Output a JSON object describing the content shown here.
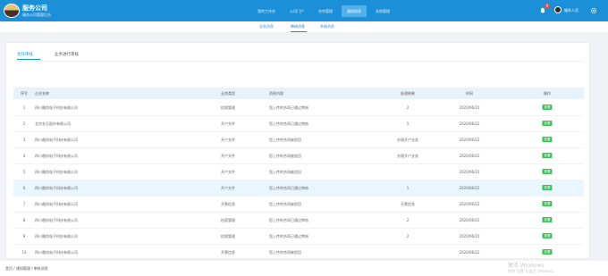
{
  "header": {
    "title": "服务公司",
    "subtitle": "服务公司管理后台",
    "nav": [
      "我的工作台",
      "公司门户",
      "合作管理",
      "通知消息",
      "系统管理"
    ],
    "active_nav": 3,
    "notification_count": "0",
    "user_name": "服务人员"
  },
  "subnav": {
    "items": [
      "业务消息",
      "审核消息",
      "系统消息"
    ],
    "active": 1
  },
  "tabs": {
    "items": [
      "合作审核",
      "业务进行审核"
    ],
    "active": 0
  },
  "table": {
    "columns": [
      "序号",
      "企业名称",
      "业务类型",
      "消息内容",
      "处理结果",
      "时间",
      "操作"
    ],
    "rows": [
      [
        "1",
        "四川雅尚电子科技有限公司",
        "档案管理",
        "您上传的合同已通过审核",
        "2",
        "2020/06/22",
        "查看"
      ],
      [
        "2",
        "北京金石股份有限公司",
        "开户文件",
        "您上传的合同已通过审核",
        "1",
        "2020/06/22",
        "查看"
      ],
      [
        "3",
        "四川雅尚电子科技有限公司",
        "开户文件",
        "您上传的合同被驳回",
        "办理开户业务",
        "2020/06/22",
        "查看"
      ],
      [
        "4",
        "四川雅尚电子科技有限公司",
        "开户文件",
        "您上传的合同被驳回",
        "办理开户业务",
        "2020/06/22",
        "查看"
      ],
      [
        "5",
        "四川雅尚电子科技有限公司",
        "开户文件",
        "您上传的合同被驳回",
        "",
        "2020/06/22",
        "查看"
      ],
      [
        "6",
        "四川雅尚电子科技有限公司",
        "开户文件",
        "您上传的合同已通过审核",
        "1",
        "2020/06/22",
        "查看"
      ],
      [
        "7",
        "四川雅尚电子科技有限公司",
        "开票信息",
        "您上传的合同被驳回",
        "开票信息",
        "2020/06/22",
        "查看"
      ],
      [
        "8",
        "四川雅尚电子科技有限公司",
        "档案管理",
        "您上传的合同已通过审核",
        "2",
        "2020/06/22",
        "查看"
      ],
      [
        "9",
        "四川雅尚电子科技有限公司",
        "档案管理",
        "您上传的合同已通过审核",
        "2",
        "2020/06/22",
        "查看"
      ],
      [
        "10",
        "四川雅尚电子科技有限公司",
        "开票信息",
        "您上传的合同被驳回",
        "",
        "2020/06/22",
        "查看"
      ]
    ],
    "highlight_row": 5
  },
  "breadcrumb": "首页 / 通知管理 / 审核消息",
  "watermark": {
    "line1": "激活 Windows",
    "line2": "转到\"设置\"以激活 Windows。"
  },
  "colors": {
    "header": "#1b8fd8",
    "action": "#3fc05c",
    "highlight": "#e9f6fd"
  }
}
